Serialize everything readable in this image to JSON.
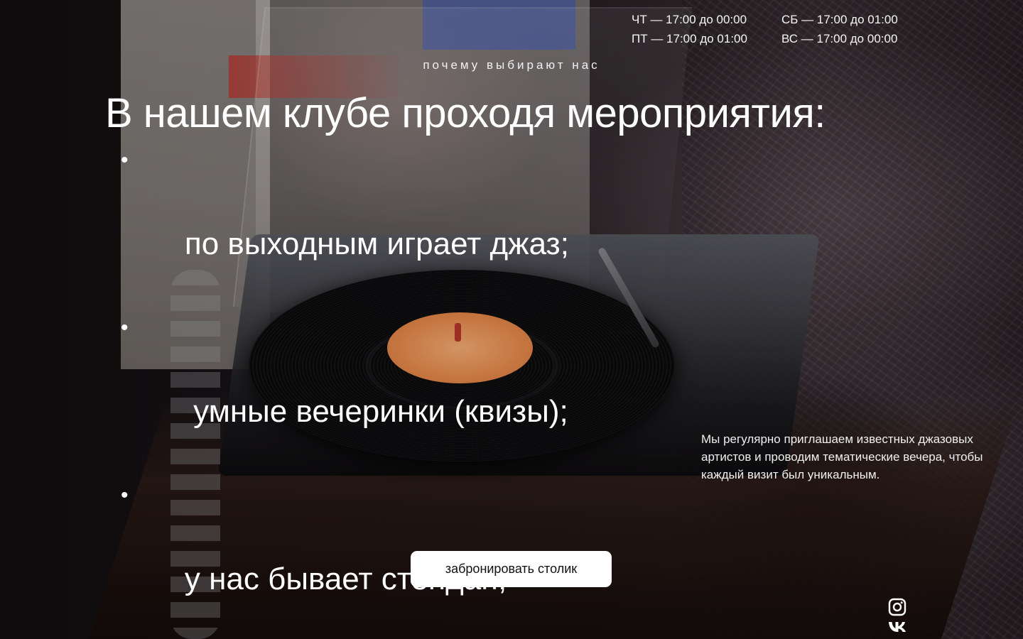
{
  "hours": {
    "left": [
      "ЧТ — 17:00 до 00:00",
      "ПТ — 17:00 до 01:00"
    ],
    "right": [
      "СБ — 17:00 до  01:00",
      "ВС — 17:00 до 00:00"
    ]
  },
  "section": {
    "kicker": "почему выбирают нас",
    "headline": "В нашем клубе проходя мероприятия:",
    "events": [
      "по выходным играет джаз;",
      " умные вечеринки (квизы);",
      "у нас бывает стендап;"
    ],
    "bullet": "•",
    "blurb": "Мы регулярно приглашаем известных джазовых артистов и проводим тематические вечера, чтобы каждый визит был уникальным."
  },
  "cta": {
    "label": "забронировать столик"
  },
  "social": {
    "icons": [
      "instagram-icon",
      "vk-icon"
    ]
  },
  "colors": {
    "text": "#ffffff",
    "button_bg": "#ffffff",
    "button_text": "#111111",
    "label_orange": "#f39452"
  }
}
